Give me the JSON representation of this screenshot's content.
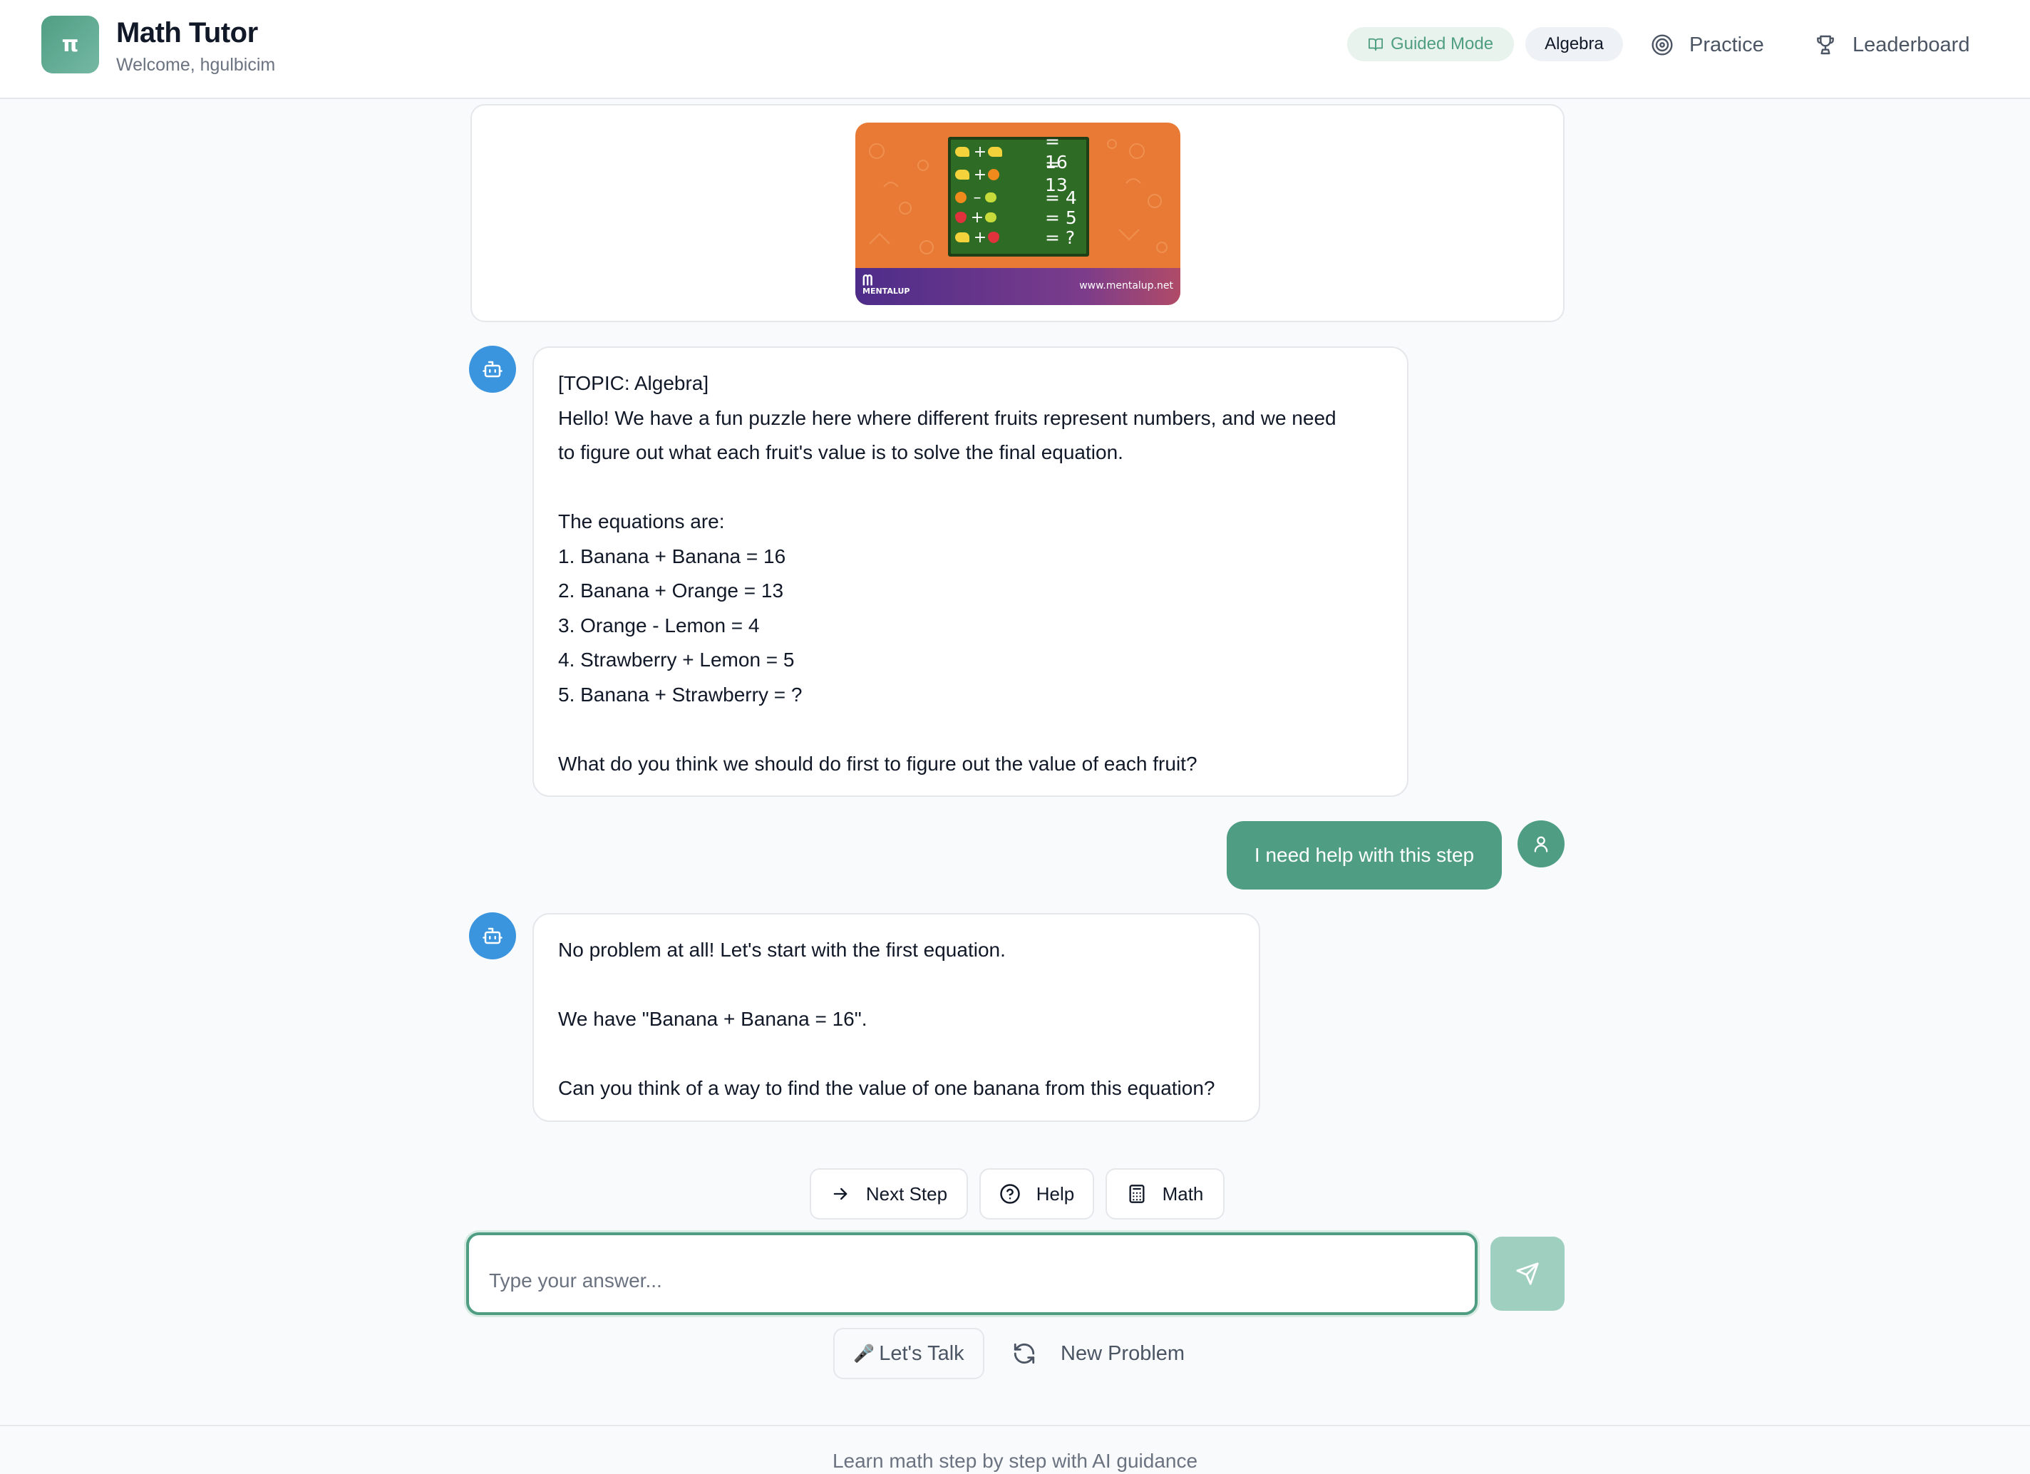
{
  "header": {
    "logo_glyph": "π",
    "title": "Math Tutor",
    "subtitle": "Welcome, hgulbicim",
    "mode_label": "Guided Mode",
    "topic_label": "Algebra",
    "nav": {
      "practice": "Practice",
      "leaderboard": "Leaderboard"
    }
  },
  "puzzle_image": {
    "rows": [
      {
        "left": "banana",
        "op": "+",
        "right": "banana",
        "result": "= 16"
      },
      {
        "left": "banana",
        "op": "+",
        "right": "orange",
        "result": "= 13"
      },
      {
        "left": "orange",
        "op": "–",
        "right": "lemon",
        "result": "= 4"
      },
      {
        "left": "strawberry",
        "op": "+",
        "right": "lemon",
        "result": "= 5"
      },
      {
        "left": "banana",
        "op": "+",
        "right": "strawberry",
        "result": "= ?"
      }
    ],
    "brand": "MENTALUP",
    "site": "www.mentalup.net"
  },
  "messages": {
    "bot_1": [
      "[TOPIC: Algebra]",
      "Hello! We have a fun puzzle here where different fruits represent numbers, and we need",
      "to figure out what each fruit's value is to solve the final equation.",
      "",
      "The equations are:",
      "1. Banana + Banana = 16",
      "2. Banana + Orange = 13",
      "3. Orange - Lemon = 4",
      "4. Strawberry + Lemon = 5",
      "5. Banana + Strawberry = ?",
      "",
      "What do you think we should do first to figure out the value of each fruit?"
    ],
    "user_1": "I need help with this step",
    "bot_2": [
      "No problem at all! Let's start with the first equation.",
      "",
      "We have \"Banana + Banana = 16\".",
      "",
      "Can you think of a way to find the value of one banana from this equation?"
    ]
  },
  "quick_actions": {
    "next_step": "Next Step",
    "help": "Help",
    "math": "Math"
  },
  "input": {
    "placeholder": "Type your answer...",
    "value": ""
  },
  "bottom_actions": {
    "talk": "Let's Talk",
    "new_problem": "New Problem"
  },
  "footer": {
    "text": "Learn math step by step with AI guidance"
  },
  "colors": {
    "accent": "#4f9e84",
    "bot_avatar": "#3b95de",
    "send_disabled": "#9fcfbe"
  }
}
